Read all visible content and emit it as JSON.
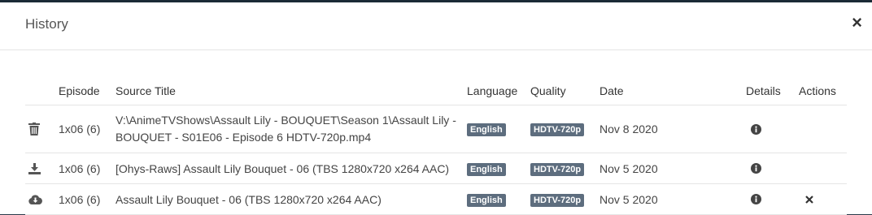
{
  "modal": {
    "title": "History",
    "close_glyph": "×"
  },
  "columns": [
    "Episode",
    "Source Title",
    "Language",
    "Quality",
    "Date",
    "Details",
    "Actions"
  ],
  "rows": [
    {
      "icon": "trash-icon",
      "episode": "1x06 (6)",
      "source_title_line1": "V:\\AnimeTVShows\\Assault Lily - BOUQUET\\Season 1\\Assault Lily -",
      "source_title_line2": "BOUQUET - S01E06 - Episode 6 HDTV-720p.mp4",
      "language": "English",
      "quality": "HDTV-720p",
      "date": "Nov 8 2020",
      "details_icon": "info-icon",
      "action": ""
    },
    {
      "icon": "download-icon",
      "episode": "1x06 (6)",
      "source_title": "[Ohys-Raws] Assault Lily Bouquet - 06 (TBS 1280x720 x264 AAC)",
      "language": "English",
      "quality": "HDTV-720p",
      "date": "Nov 5 2020",
      "details_icon": "info-icon",
      "action": ""
    },
    {
      "icon": "cloud-download-icon",
      "episode": "1x06 (6)",
      "source_title": "Assault Lily Bouquet - 06 (TBS 1280x720 x264 AAC)",
      "language": "English",
      "quality": "HDTV-720p",
      "date": "Nov 5 2020",
      "details_icon": "info-icon",
      "action_icon": "close-icon"
    }
  ],
  "colors": {
    "label_bg": "#5d6d7e",
    "header_bar": "#1b2b36"
  }
}
